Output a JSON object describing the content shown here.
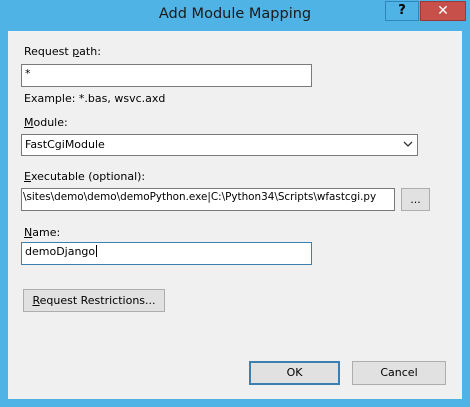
{
  "window": {
    "title": "Add Module Mapping",
    "help_label": "?",
    "close_label": "✕"
  },
  "form": {
    "request_path": {
      "label_pre": "Request ",
      "label_u": "p",
      "label_post": "ath:",
      "value": "*",
      "example": "Example: *.bas, wsvc.axd"
    },
    "module": {
      "label_pre": "",
      "label_u": "M",
      "label_post": "odule:",
      "value": "FastCgiModule"
    },
    "executable": {
      "label_pre": "",
      "label_u": "E",
      "label_post": "xecutable (optional):",
      "value": "\\sites\\demo\\demo\\demoPython.exe|C:\\Python34\\Scripts\\wfastcgi.py",
      "browse_label": "..."
    },
    "name": {
      "label_pre": "",
      "label_u": "N",
      "label_post": "ame:",
      "value": "demoDjango"
    },
    "request_restrictions": {
      "label_u": "R",
      "label_post": "equest Restrictions..."
    }
  },
  "footer": {
    "ok_label": "OK",
    "cancel_label": "Cancel"
  }
}
